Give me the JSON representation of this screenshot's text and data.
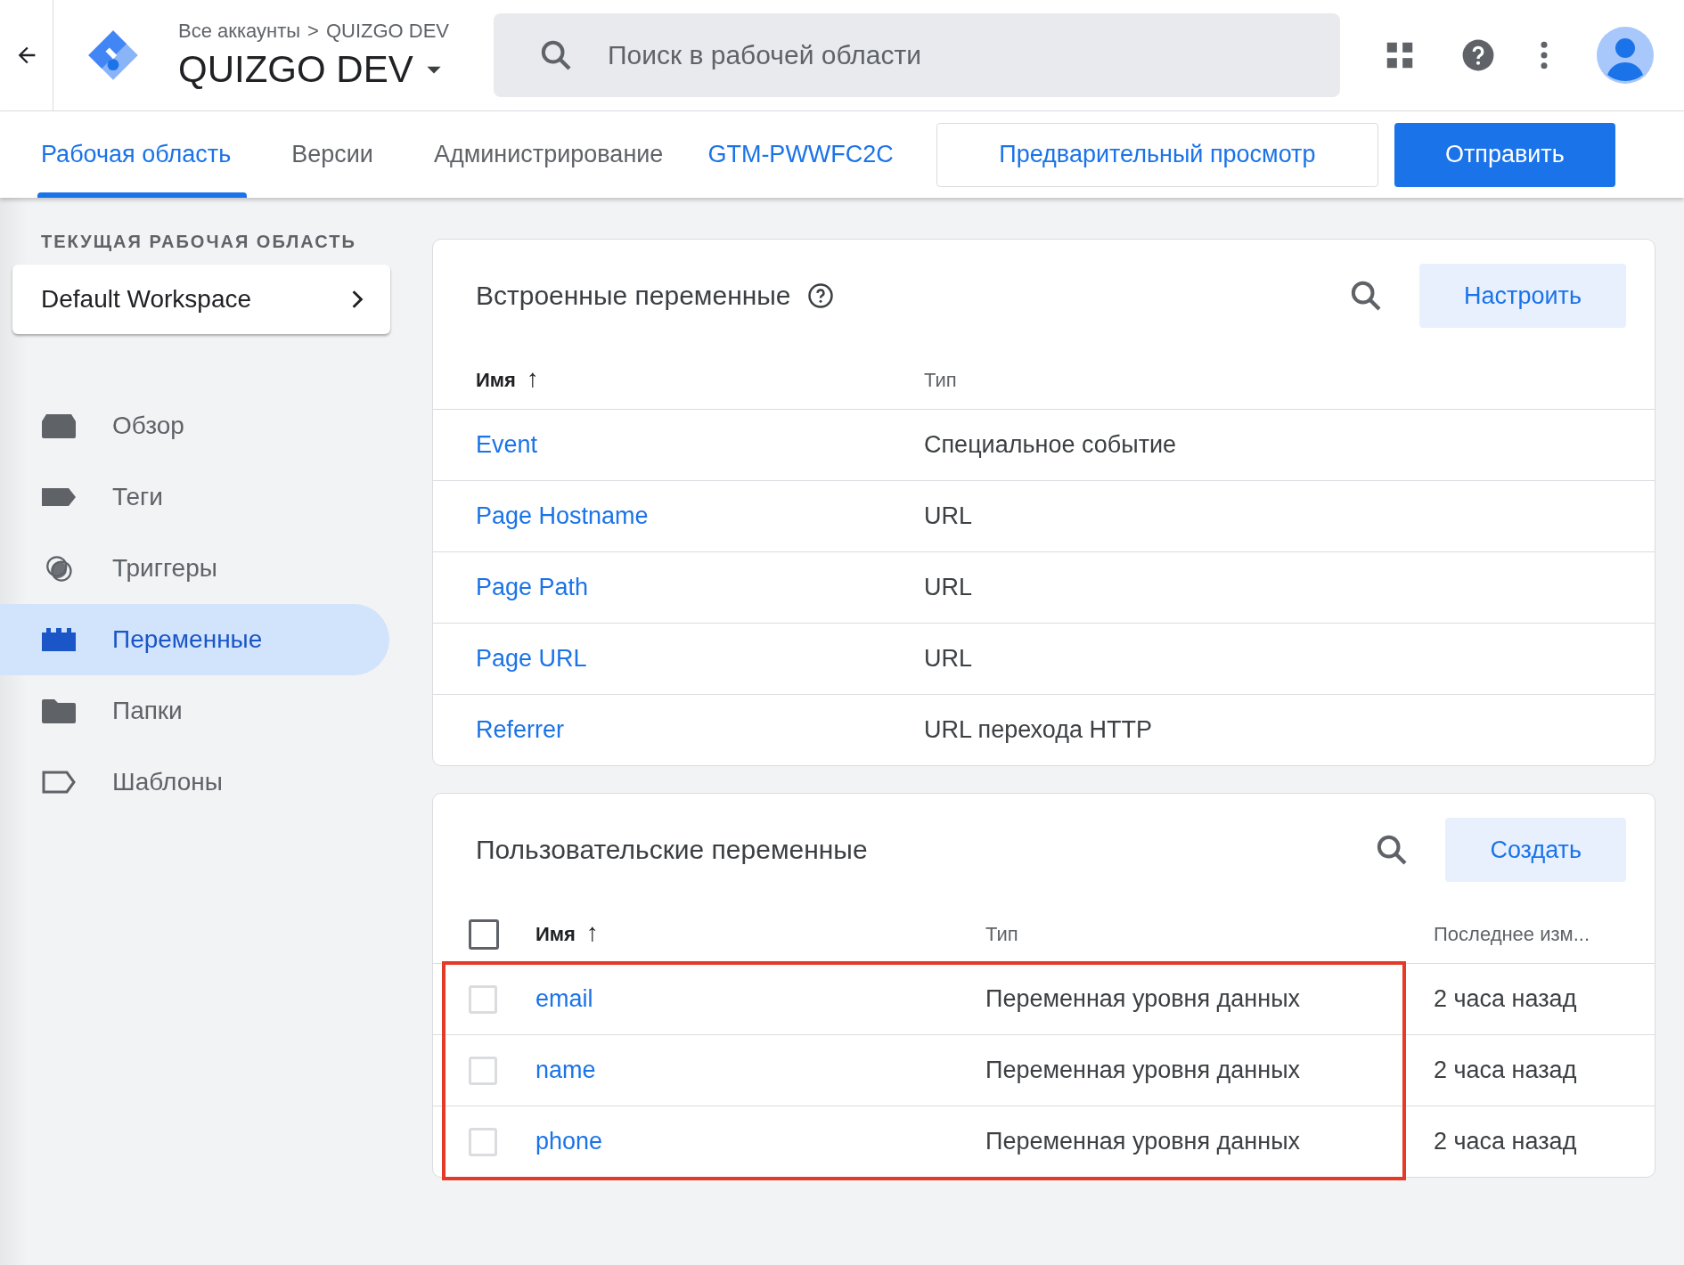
{
  "header": {
    "breadcrumb": "Все аккаунты",
    "breadcrumb_separator": ">",
    "breadcrumb_current": "QUIZGO DEV",
    "container": "QUIZGO DEV",
    "search": {
      "placeholder": "Поиск в рабочей области"
    }
  },
  "tabs": [
    {
      "label": "Рабочая область",
      "selected": true
    },
    {
      "label": "Версии",
      "selected": false
    },
    {
      "label": "Администрирование",
      "selected": false
    }
  ],
  "container_id": "GTM-PWWFC2C",
  "buttons": {
    "preview": "Предварительный просмотр",
    "submit": "Отправить"
  },
  "sidebar": {
    "section_label": "ТЕКУЩАЯ РАБОЧАЯ ОБЛАСТЬ",
    "workspace": "Default Workspace",
    "items": [
      {
        "label": "Обзор",
        "kind": "overview",
        "selected": false
      },
      {
        "label": "Теги",
        "kind": "tags",
        "selected": false
      },
      {
        "label": "Триггеры",
        "kind": "triggers",
        "selected": false
      },
      {
        "label": "Переменные",
        "kind": "variables",
        "selected": true
      },
      {
        "label": "Папки",
        "kind": "folders",
        "selected": false
      },
      {
        "label": "Шаблоны",
        "kind": "templates",
        "selected": false
      }
    ]
  },
  "builtin": {
    "title": "Встроенные переменные",
    "button": "Настроить",
    "columns": [
      "Имя",
      "Тип"
    ],
    "sort_arrow": "↑",
    "rows": [
      {
        "name": "Event",
        "type": "Специальное событие"
      },
      {
        "name": "Page Hostname",
        "type": "URL"
      },
      {
        "name": "Page Path",
        "type": "URL"
      },
      {
        "name": "Page URL",
        "type": "URL"
      },
      {
        "name": "Referrer",
        "type": "URL перехода HTTP"
      }
    ]
  },
  "custom": {
    "title": "Пользовательские переменные",
    "button": "Создать",
    "columns": [
      "Имя",
      "Тип",
      "Последнее изм..."
    ],
    "sort_arrow": "↑",
    "select_all_checked": false,
    "rows": [
      {
        "name": "email",
        "type": "Переменная уровня данных",
        "modified": "2 часа назад",
        "checked": false,
        "highlighted": true
      },
      {
        "name": "name",
        "type": "Переменная уровня данных",
        "modified": "2 часа назад",
        "checked": false,
        "highlighted": true
      },
      {
        "name": "phone",
        "type": "Переменная уровня данных",
        "modified": "2 часа назад",
        "checked": false,
        "highlighted": true
      }
    ]
  }
}
